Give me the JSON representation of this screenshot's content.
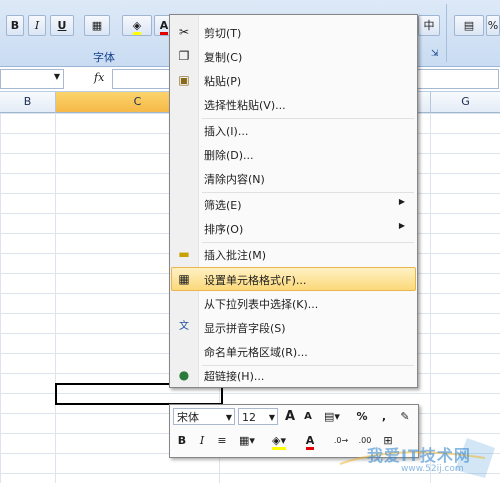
{
  "ribbon": {
    "bold": "B",
    "italic": "I",
    "underline": "U",
    "font_color_glyph": "A",
    "font_group_label": "字体",
    "align_glyph": "中",
    "percent": "%"
  },
  "formula_bar": {
    "fx": "fx"
  },
  "columns": [
    "B",
    "C",
    "G"
  ],
  "context_menu": {
    "items": [
      {
        "label": "剪切(T)",
        "icon": "scissors-icon"
      },
      {
        "label": "复制(C)",
        "icon": "copy-icon"
      },
      {
        "label": "粘贴(P)",
        "icon": "paste-icon"
      },
      {
        "label": "选择性粘贴(V)..."
      },
      {
        "label": "插入(I)..."
      },
      {
        "label": "删除(D)..."
      },
      {
        "label": "清除内容(N)"
      },
      {
        "label": "筛选(E)",
        "submenu": true
      },
      {
        "label": "排序(O)",
        "submenu": true
      },
      {
        "label": "插入批注(M)",
        "icon": "comment-icon"
      },
      {
        "label": "设置单元格格式(F)...",
        "icon": "format-cells-icon",
        "highlighted": true
      },
      {
        "label": "从下拉列表中选择(K)..."
      },
      {
        "label": "显示拼音字段(S)",
        "icon": "phonetic-icon"
      },
      {
        "label": "命名单元格区域(R)..."
      },
      {
        "label": "超链接(H)...",
        "icon": "hyperlink-icon"
      }
    ]
  },
  "mini_toolbar": {
    "font_name": "宋体",
    "font_size": "12",
    "grow": "A",
    "shrink": "A",
    "percent": "%",
    "comma": ",",
    "bold": "B",
    "italic": "I",
    "font_color_glyph": "A"
  },
  "watermark": {
    "text": "我爱IT技术网",
    "url": "www.52ij.com"
  },
  "colors": {
    "highlight": "#fbd97a",
    "selected_col": "#f6b947",
    "ribbon": "#c9dcf2"
  }
}
